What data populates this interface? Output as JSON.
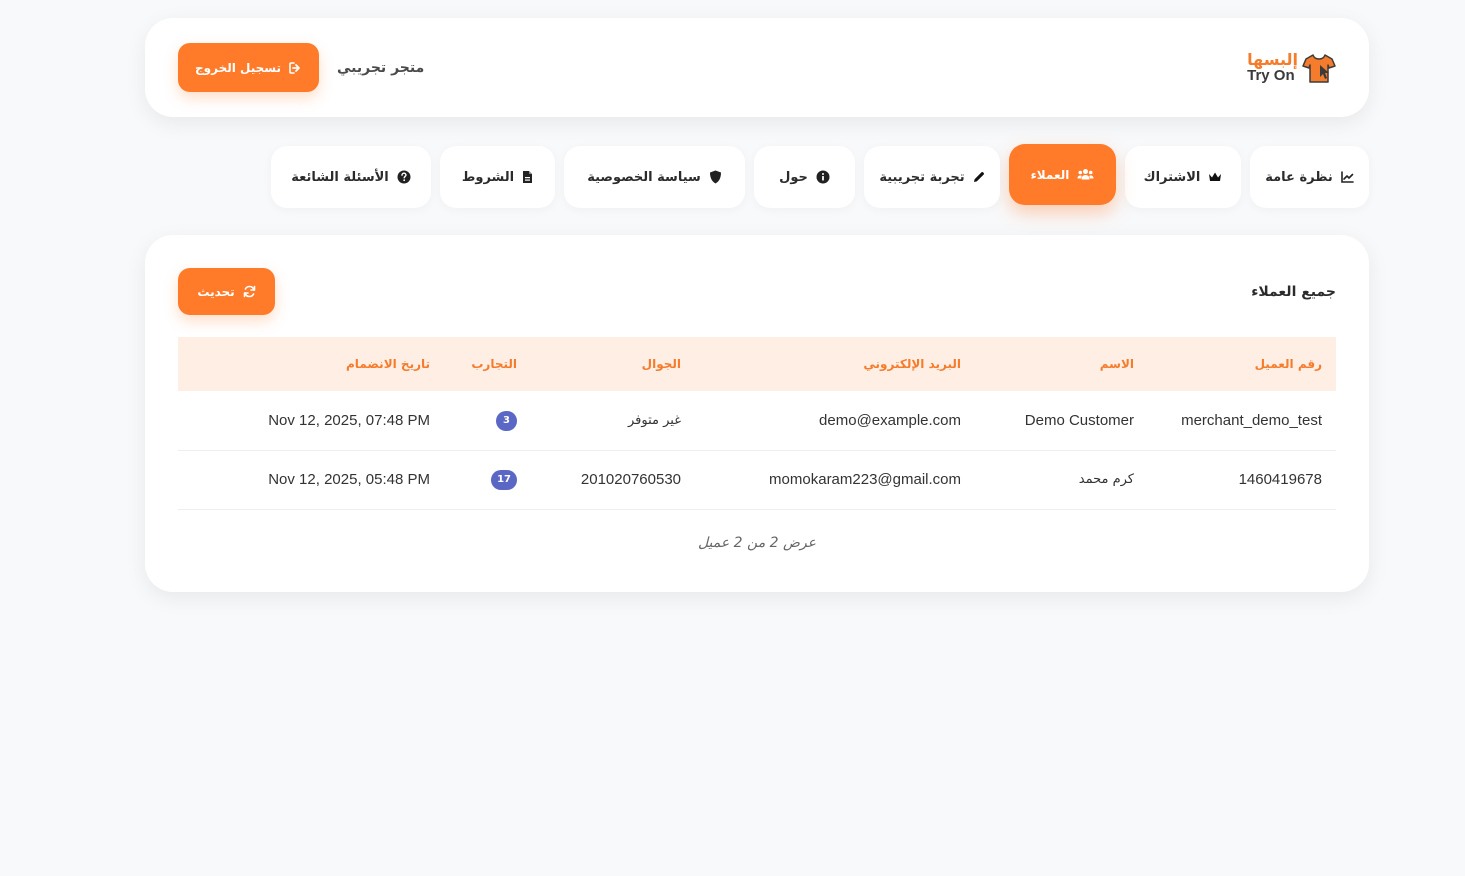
{
  "header": {
    "logo_ar": "إلبسها",
    "logo_en": "Try On",
    "store_name": "متجر تجريبي",
    "logout_label": "تسجيل الخروج"
  },
  "tabs": [
    {
      "key": "overview",
      "label": "نظرة عامة",
      "icon": "chart-line-icon",
      "active": false
    },
    {
      "key": "subscription",
      "label": "الاشتراك",
      "icon": "crown-icon",
      "active": false
    },
    {
      "key": "customers",
      "label": "العملاء",
      "icon": "users-icon",
      "active": true
    },
    {
      "key": "trial",
      "label": "تجربة تجريبية",
      "icon": "pencil-icon",
      "active": false
    },
    {
      "key": "about",
      "label": "حول",
      "icon": "info-icon",
      "active": false
    },
    {
      "key": "privacy",
      "label": "سياسة الخصوصية",
      "icon": "shield-icon",
      "active": false
    },
    {
      "key": "terms",
      "label": "الشروط",
      "icon": "document-icon",
      "active": false
    },
    {
      "key": "faq",
      "label": "الأسئلة الشائعة",
      "icon": "question-icon",
      "active": false
    }
  ],
  "main": {
    "title": "جميع العملاء",
    "refresh_label": "تحديث",
    "table": {
      "headers": [
        "رقم العميل",
        "الاسم",
        "البريد الإلكتروني",
        "الجوال",
        "التجارب",
        "تاريخ الانضمام"
      ],
      "rows": [
        {
          "id": "merchant_demo_test",
          "name": "Demo Customer",
          "email": "demo@example.com",
          "phone": "غير متوفر",
          "trials": "3",
          "joined": "Nov 12, 2025, 07:48 PM"
        },
        {
          "id": "1460419678",
          "name": "كرم محمد",
          "email": "momokaram223@gmail.com",
          "phone": "201020760530",
          "trials": "17",
          "joined": "Nov 12, 2025, 05:48 PM"
        }
      ]
    },
    "footer_note": "عرض 2 من 2 عميل"
  },
  "colors": {
    "accent": "#ff7a29",
    "header_bg": "#ffeee4",
    "header_text": "#f57c2c",
    "badge": "#5a67c4",
    "page_bg": "#f8f9fb"
  }
}
